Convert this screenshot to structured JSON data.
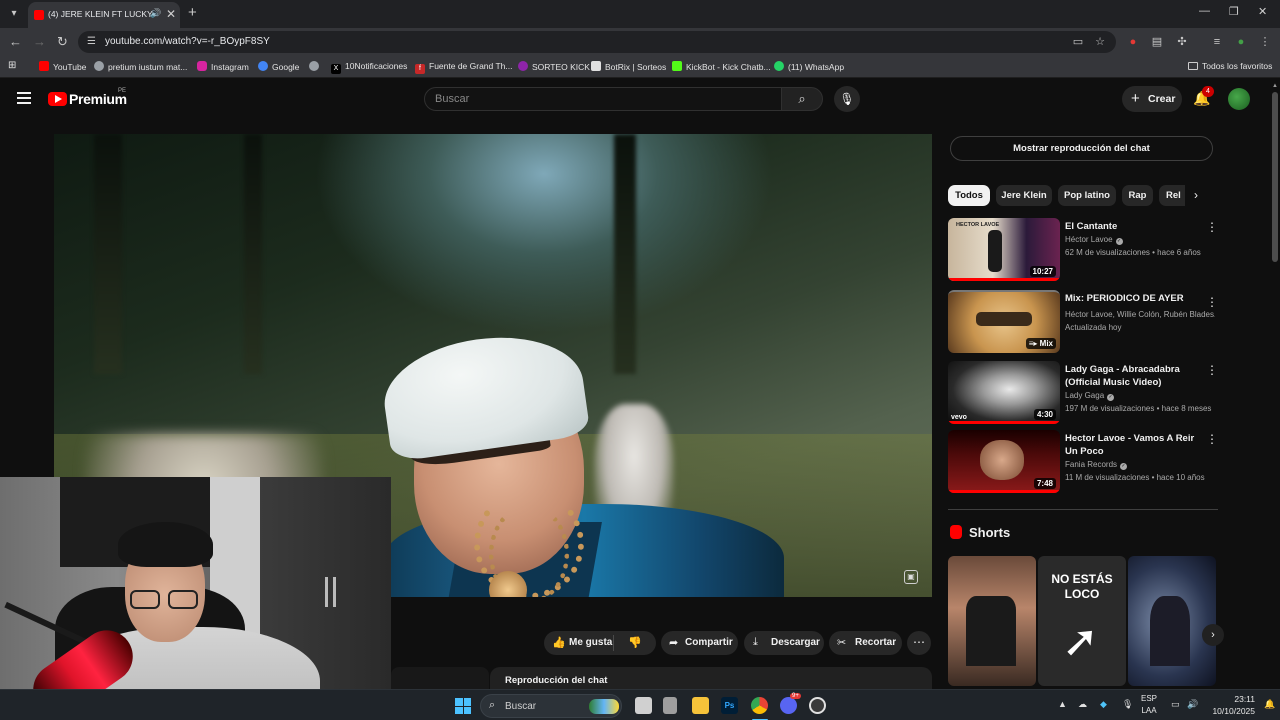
{
  "browser": {
    "tab_title": "(4) JERE KLEIN FT LUCKY BR",
    "url": "youtube.com/watch?v=-r_BOypF8SY",
    "bookmarks": [
      {
        "label": "YouTube",
        "color": "#ff0000"
      },
      {
        "label": "pretium iustum mat...",
        "color": "#9aa0a6"
      },
      {
        "label": "Instagram",
        "color": "#d6249f"
      },
      {
        "label": "Google",
        "color": "#4285f4"
      },
      {
        "label": "",
        "color": "#9aa0a6"
      },
      {
        "label": "10Notificaciones",
        "color": "#000000"
      },
      {
        "label": "Fuente de Grand Th...",
        "color": "#c62828"
      },
      {
        "label": "SORTEO KICK",
        "color": "#8e24aa"
      },
      {
        "label": "BotRix | Sorteos",
        "color": "#e0e0e0"
      },
      {
        "label": "KickBot - Kick Chatb...",
        "color": "#53fc18"
      },
      {
        "label": "(11) WhatsApp",
        "color": "#25d366"
      }
    ],
    "all_bookmarks_label": "Todos los favoritos"
  },
  "youtube": {
    "logo_text": "Premium",
    "country_code": "PE",
    "search_placeholder": "Buscar",
    "create_label": "Crear",
    "notifications_count": "4"
  },
  "video_actions": {
    "like_label": "Me gusta",
    "share_label": "Compartir",
    "download_label": "Descargar",
    "clip_label": "Recortar"
  },
  "chat_replay_bottom": "Reproducción del chat",
  "sidebar": {
    "show_chat_label": "Mostrar reproducción del chat",
    "chips": [
      "Todos",
      "Jere Klein",
      "Pop latino",
      "Rap",
      "Rel"
    ],
    "recommendations": [
      {
        "title": "El Cantante",
        "channel": "Héctor Lavoe",
        "verified": true,
        "meta": "62 M de visualizaciones • hace 6 años",
        "duration": "10:27",
        "thumb_label": "HECTOR LAVOE"
      },
      {
        "title": "Mix: PERIODICO DE AYER",
        "channel": "Héctor Lavoe, Willie Colón, Rubén Blades...",
        "verified": false,
        "meta": "Actualizada hoy",
        "duration": "Mix",
        "thumb_label": ""
      },
      {
        "title": "Lady Gaga - Abracadabra (Official Music Video)",
        "channel": "Lady Gaga",
        "verified": true,
        "meta": "197 M de visualizaciones • hace 8 meses",
        "duration": "4:30",
        "thumb_label": "vevo"
      },
      {
        "title": "Hector Lavoe - Vamos A Reir Un Poco",
        "channel": "Fania Records",
        "verified": true,
        "meta": "11 M de visualizaciones • hace 10 años",
        "duration": "7:48",
        "thumb_label": ""
      }
    ],
    "shorts_title": "Shorts",
    "shorts_overlay_text": "NO ESTÁS LOCO"
  },
  "taskbar": {
    "search_label": "Buscar",
    "lang_top": "ESP",
    "lang_bottom": "LAA",
    "time": "23:11",
    "date": "10/10/2025",
    "discord_badge": "9+"
  }
}
